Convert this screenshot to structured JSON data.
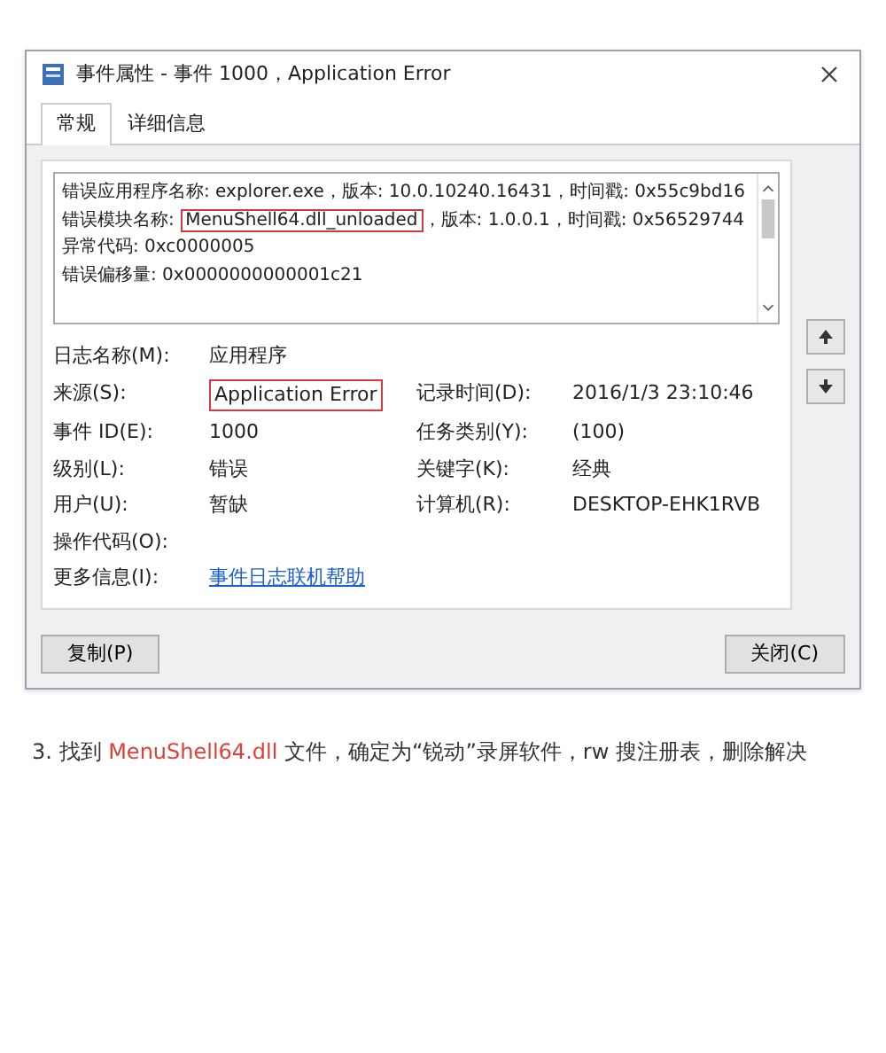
{
  "dialog": {
    "title": "事件属性 - 事件 1000，Application Error",
    "tabs": [
      {
        "label": "常规",
        "selected": true
      },
      {
        "label": "详细信息",
        "selected": false
      }
    ],
    "description_lines": [
      [
        {
          "text": "错误应用程序名称: explorer.exe，版本: 10.0.10240.16431，时间戳: 0x55c9bd16",
          "boxed": false
        }
      ],
      [
        {
          "text": "错误模块名称: ",
          "boxed": false
        },
        {
          "text": "MenuShell64.dll_unloaded",
          "boxed": true
        },
        {
          "text": "，版本: 1.0.0.1，时间戳: 0x56529744",
          "boxed": false
        }
      ],
      [
        {
          "text": "异常代码: 0xc0000005",
          "boxed": false
        }
      ],
      [
        {
          "text": "错误偏移量: 0x0000000000001c21",
          "boxed": false
        }
      ]
    ],
    "fields": [
      [
        {
          "label": "日志名称(M):",
          "value": "应用程序",
          "boxed": false
        }
      ],
      [
        {
          "label": "来源(S):",
          "value": "Application Error",
          "boxed": true
        },
        {
          "label": "记录时间(D):",
          "value": "2016/1/3 23:10:46",
          "boxed": false
        }
      ],
      [
        {
          "label": "事件 ID(E):",
          "value": "1000",
          "boxed": false
        },
        {
          "label": "任务类别(Y):",
          "value": "(100)",
          "boxed": false
        }
      ],
      [
        {
          "label": "级别(L):",
          "value": "错误",
          "boxed": false
        },
        {
          "label": "关键字(K):",
          "value": "经典",
          "boxed": false
        }
      ],
      [
        {
          "label": "用户(U):",
          "value": "暂缺",
          "boxed": false
        },
        {
          "label": "计算机(R):",
          "value": "DESKTOP-EHK1RVB",
          "boxed": false
        }
      ],
      [
        {
          "label": "操作代码(O):",
          "boxed": false
        }
      ],
      [
        {
          "label": "更多信息(I):",
          "link": "事件日志联机帮助",
          "boxed": false
        }
      ]
    ],
    "buttons": [
      "复制(P)",
      "关闭(C)"
    ]
  },
  "caption": [
    {
      "text": "3. 找到 ",
      "emphasis": false
    },
    {
      "text": "MenuShell64.dll",
      "emphasis": true
    },
    {
      "text": " 文件，确定为“锐动”录屏软件，rw 搜注册表，删除解决",
      "emphasis": false
    }
  ]
}
